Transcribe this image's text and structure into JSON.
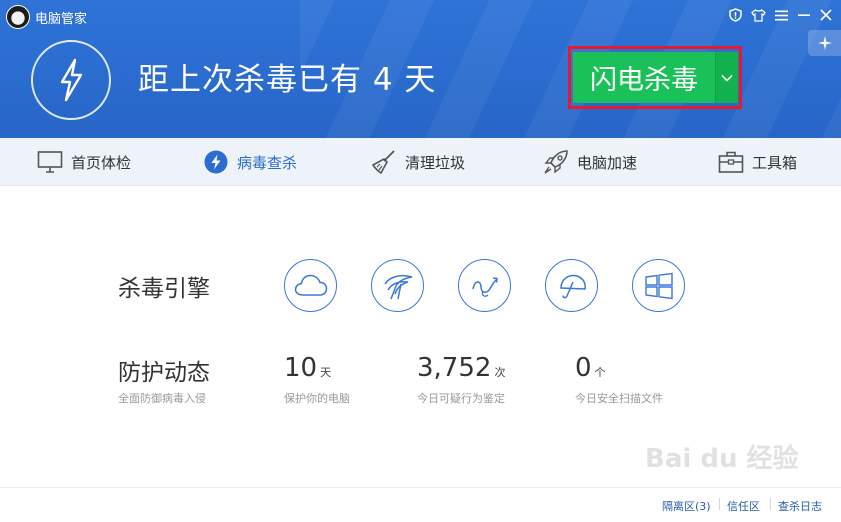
{
  "app": {
    "title": "电脑管家"
  },
  "header": {
    "headline": "距上次杀毒已有 4 天",
    "scan_button": "闪电杀毒"
  },
  "nav": {
    "items": [
      {
        "label": "首页体检",
        "icon": "monitor-icon"
      },
      {
        "label": "病毒查杀",
        "icon": "bolt-icon"
      },
      {
        "label": "清理垃圾",
        "icon": "broom-icon"
      },
      {
        "label": "电脑加速",
        "icon": "rocket-icon"
      },
      {
        "label": "工具箱",
        "icon": "toolbox-icon"
      }
    ],
    "active": "病毒查杀"
  },
  "engines": {
    "title": "杀毒引擎",
    "icons": [
      "cloud-icon",
      "eagle-icon",
      "behavior-icon",
      "umbrella-icon",
      "windows-icon"
    ]
  },
  "protection": {
    "title": "防护动态",
    "subtitle": "全面防御病毒入侵",
    "stats": [
      {
        "value": "10",
        "unit": "天",
        "desc": "保护你的电脑"
      },
      {
        "value": "3,752",
        "unit": "次",
        "desc": "今日可疑行为鉴定"
      },
      {
        "value": "0",
        "unit": "个",
        "desc": "今日安全扫描文件"
      }
    ]
  },
  "footer": {
    "links": [
      "隔离区(3)",
      "信任区",
      "查杀日志"
    ]
  },
  "watermark": "Bai du 经验",
  "colors": {
    "header_blue": "#2a6ccf",
    "scan_green": "#19c158",
    "highlight_red": "#e8192c",
    "nav_bg": "#eef3fa",
    "link_blue": "#2a5ca8"
  }
}
